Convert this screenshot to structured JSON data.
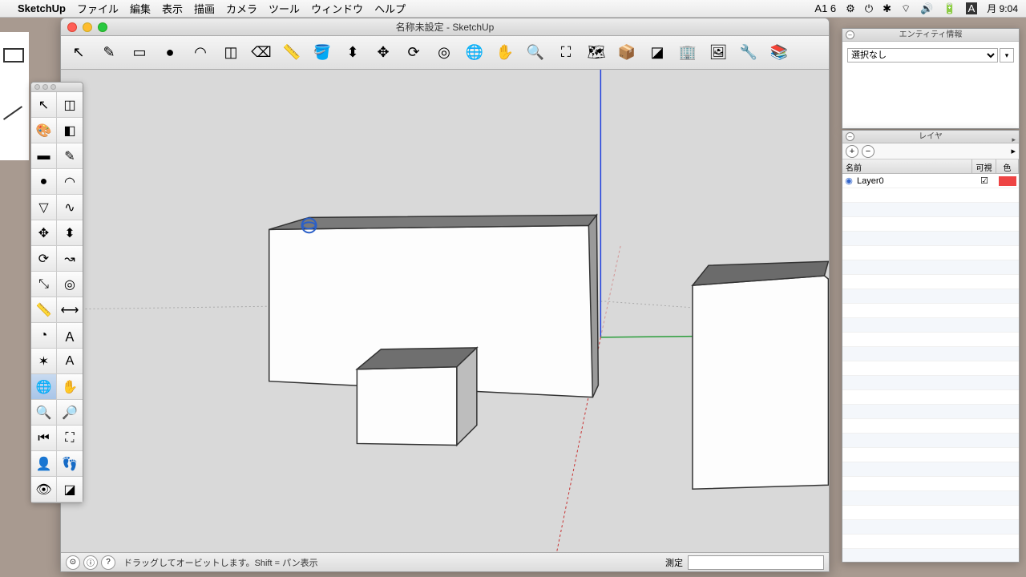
{
  "menubar": {
    "appname": "SketchUp",
    "items": [
      "ファイル",
      "編集",
      "表示",
      "描画",
      "カメラ",
      "ツール",
      "ウィンドウ",
      "ヘルプ"
    ],
    "clock": "月 9:04",
    "status_icons": [
      "A1 6",
      "⚙",
      "⏻",
      "✱",
      "⇪",
      "🔊",
      "🔋",
      "A"
    ]
  },
  "window": {
    "title": "名称未設定 - SketchUp"
  },
  "top_tools": [
    {
      "name": "select-arrow",
      "glyph": "↖"
    },
    {
      "name": "line-tool",
      "glyph": "✎"
    },
    {
      "name": "rectangle-tool",
      "glyph": "▭"
    },
    {
      "name": "circle-tool",
      "glyph": "●"
    },
    {
      "name": "arc-tool",
      "glyph": "◠"
    },
    {
      "name": "make-component",
      "glyph": "◫"
    },
    {
      "name": "eraser-tool",
      "glyph": "⌫"
    },
    {
      "name": "tape-measure",
      "glyph": "📏"
    },
    {
      "name": "paint-bucket",
      "glyph": "🪣"
    },
    {
      "name": "push-pull",
      "glyph": "⬍"
    },
    {
      "name": "move-tool",
      "glyph": "✥"
    },
    {
      "name": "rotate-tool",
      "glyph": "⟳"
    },
    {
      "name": "offset-tool",
      "glyph": "◎"
    },
    {
      "name": "orbit-tool",
      "glyph": "🌐"
    },
    {
      "name": "pan-tool",
      "glyph": "✋"
    },
    {
      "name": "zoom-tool",
      "glyph": "🔍"
    },
    {
      "name": "zoom-extents",
      "glyph": "⛶"
    },
    {
      "name": "add-location",
      "glyph": "🗺"
    },
    {
      "name": "get-models",
      "glyph": "📦"
    },
    {
      "name": "section-plane",
      "glyph": "◪"
    },
    {
      "name": "building-maker",
      "glyph": "🏢"
    },
    {
      "name": "photo-textures",
      "glyph": "🖼"
    },
    {
      "name": "extension-warehouse",
      "glyph": "🔧"
    },
    {
      "name": "layers-tool",
      "glyph": "📚"
    }
  ],
  "left_tools": [
    {
      "name": "select",
      "glyph": "↖"
    },
    {
      "name": "make-component",
      "glyph": "◫"
    },
    {
      "name": "paint-bucket",
      "glyph": "🎨"
    },
    {
      "name": "eraser",
      "glyph": "◧"
    },
    {
      "name": "rectangle",
      "glyph": "▬"
    },
    {
      "name": "line",
      "glyph": "✎"
    },
    {
      "name": "circle",
      "glyph": "●"
    },
    {
      "name": "arc",
      "glyph": "◠"
    },
    {
      "name": "polygon",
      "glyph": "▽"
    },
    {
      "name": "freehand",
      "glyph": "∿"
    },
    {
      "name": "move",
      "glyph": "✥"
    },
    {
      "name": "push-pull",
      "glyph": "⬍"
    },
    {
      "name": "rotate",
      "glyph": "⟳"
    },
    {
      "name": "follow-me",
      "glyph": "↝"
    },
    {
      "name": "scale",
      "glyph": "⤡"
    },
    {
      "name": "offset",
      "glyph": "◎"
    },
    {
      "name": "tape-measure",
      "glyph": "📏"
    },
    {
      "name": "dimension",
      "glyph": "⟷"
    },
    {
      "name": "protractor",
      "glyph": "◔"
    },
    {
      "name": "text",
      "glyph": "Ａ"
    },
    {
      "name": "axes",
      "glyph": "✶"
    },
    {
      "name": "3d-text",
      "glyph": "A"
    },
    {
      "name": "orbit",
      "glyph": "🌐",
      "active": true
    },
    {
      "name": "pan",
      "glyph": "✋"
    },
    {
      "name": "zoom",
      "glyph": "🔍"
    },
    {
      "name": "zoom-window",
      "glyph": "🔎"
    },
    {
      "name": "previous",
      "glyph": "⏮"
    },
    {
      "name": "zoom-extents",
      "glyph": "⛶"
    },
    {
      "name": "position-camera",
      "glyph": "👤"
    },
    {
      "name": "walk",
      "glyph": "👣"
    },
    {
      "name": "look-around",
      "glyph": "👁"
    },
    {
      "name": "section",
      "glyph": "◪"
    }
  ],
  "statusbar": {
    "hint": "ドラッグしてオービットします。Shift = パン表示",
    "measure_label": "測定",
    "measure_value": ""
  },
  "entity_panel": {
    "title": "エンティティ情報",
    "selection": "選択なし"
  },
  "layers_panel": {
    "title": "レイヤ",
    "headers": {
      "name": "名前",
      "visible": "可視",
      "color": "色"
    },
    "rows": [
      {
        "name": "Layer0",
        "visible": true,
        "color": "#ee4444"
      }
    ]
  }
}
